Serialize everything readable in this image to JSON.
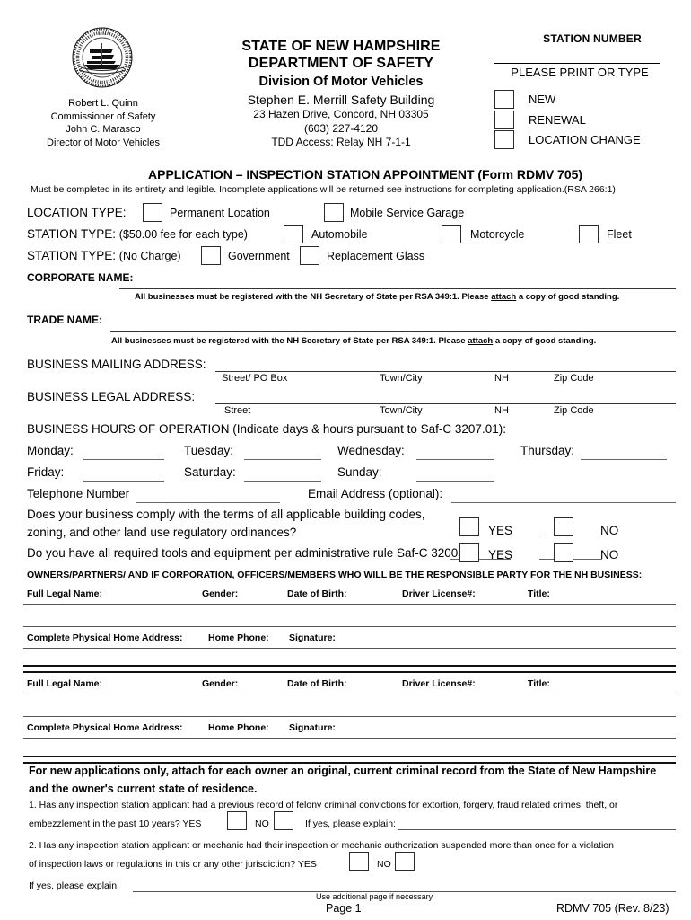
{
  "header": {
    "seal_alt": "state-seal",
    "officials": [
      "Robert L. Quinn",
      "Commissioner of Safety",
      "John C. Marasco",
      "Director of Motor Vehicles"
    ],
    "line1": "STATE OF NEW HAMPSHIRE",
    "line2": "DEPARTMENT OF SAFETY",
    "line3": "Division Of Motor Vehicles",
    "line4": "Stephen E. Merrill Safety Building",
    "line5": "23 Hazen Drive, Concord, NH 03305",
    "line6": "(603) 227-4120",
    "line7": "TDD Access:  Relay NH 7-1-1",
    "station_number_label": "STATION NUMBER",
    "print_or_type": "PLEASE PRINT OR TYPE",
    "options": [
      "NEW",
      "RENEWAL",
      "LOCATION CHANGE"
    ]
  },
  "form": {
    "title": "APPLICATION – INSPECTION STATION APPOINTMENT (Form RDMV 705)",
    "instruction": "Must be completed in its entirety and legible. Incomplete applications will be returned see instructions for completing application.(RSA 266:1)",
    "location_type_label": "LOCATION TYPE:",
    "location_options": [
      "Permanent Location",
      "Mobile Service Garage"
    ],
    "station_type_fee_label": "STATION TYPE: ",
    "station_type_fee_bold": "($50.00 fee for each type)",
    "station_fee_options": [
      "Automobile",
      "Motorcycle",
      "Fleet"
    ],
    "station_type_free_label": "STATION TYPE:  ",
    "station_type_free_bold": "(No Charge)",
    "station_free_options": [
      "Government",
      "Replacement Glass"
    ],
    "corporate_name_label": "CORPORATE NAME:",
    "registration_notice": "All businesses must be registered with the NH Secretary of State per RSA 349:1. Please attach a copy of good standing.",
    "registration_notice_pre": "All businesses must be registered with the NH Secretary of State per RSA 349:1. Please ",
    "registration_notice_underline": "attach",
    "registration_notice_post": " a copy of good standing.",
    "trade_name_label": "TRADE NAME:",
    "mailing_address_label": "BUSINESS MAILING ADDRESS:",
    "mailing_sublabels": [
      "Street/ PO Box",
      "Town/City",
      "NH",
      "Zip Code"
    ],
    "legal_address_label": "BUSINESS LEGAL ADDRESS:",
    "legal_sublabels": [
      "Street",
      "Town/City",
      "NH",
      "Zip Code"
    ],
    "hours_label": "BUSINESS HOURS OF OPERATION (Indicate days & hours pursuant to Saf-C 3207.01):",
    "days_row1": [
      "Monday:",
      "Tuesday:",
      "Wednesday:",
      "Thursday:"
    ],
    "days_row2": [
      "Friday:",
      "Saturday:",
      "Sunday:"
    ],
    "telephone_label": "Telephone Number",
    "email_label": "Email Address (optional):",
    "question_building_line1": "Does your business comply with the terms of all applicable building codes,",
    "question_building_line2": "zoning, and other land  use regulatory ordinances?",
    "question_tools": "Do you have all required tools and equipment per administrative rule Saf-C 3200",
    "yes_label": "YES",
    "no_label": "NO",
    "owners_heading": "OWNERS/PARTNERS/ AND IF CORPORATION, OFFICERS/MEMBERS WHO WILL BE THE RESPONSIBLE PARTY FOR THE NH BUSINESS:",
    "owner_row_a": [
      "Full Legal Name:",
      "Gender:",
      "Date of Birth:",
      "Driver License#:",
      "Title:"
    ],
    "owner_row_b": [
      "Complete Physical Home Address:",
      "Home Phone:",
      "Signature:"
    ]
  },
  "criminal": {
    "notice_line1": "For new applications only, attach for each owner an original, current criminal record from the State of New Hampshire",
    "notice_line2": "and the owner's current state of residence.",
    "q1_line1": "1. Has any inspection station applicant had a previous record of felony criminal convictions for extortion, forgery, fraud related crimes, theft, or",
    "q1_line2": "embezzlement in the past 10 years?",
    "q2_line1": "2. Has any inspection station applicant or mechanic had their inspection or mechanic authorization suspended more than once for a violation",
    "q2_line2": "of inspection laws or regulations in this or any other jurisdiction?",
    "yes_label": "YES",
    "no_label": "NO",
    "if_yes_label": "If yes, please explain:",
    "if_yes_label2": "If yes, please explain:"
  },
  "footer": {
    "note": "Use additional page if necessary",
    "page": "Page 1",
    "form_code": "RDMV 705 (Rev. 8/23)"
  }
}
